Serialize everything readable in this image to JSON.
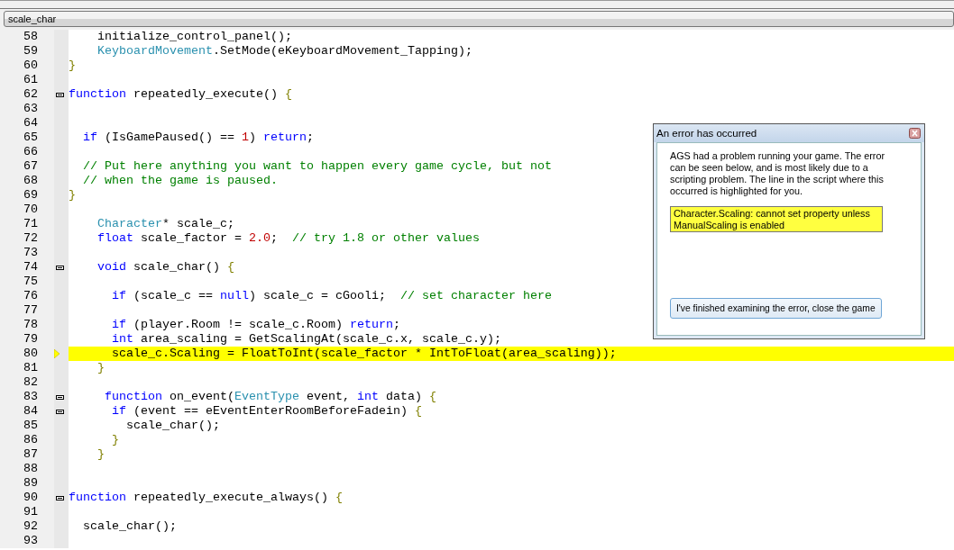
{
  "function_selector": {
    "value": "scale_char"
  },
  "code_lines": [
    {
      "number": "58",
      "fold": false,
      "current": false,
      "tokens": [
        {
          "kind": "plain",
          "text": "    initialize_control_panel();"
        }
      ]
    },
    {
      "number": "59",
      "fold": false,
      "current": false,
      "tokens": [
        {
          "kind": "type",
          "text": "    KeyboardMovement"
        },
        {
          "kind": "plain",
          "text": ".SetMode(eKeyboardMovement_Tapping);"
        }
      ]
    },
    {
      "number": "60",
      "fold": false,
      "current": false,
      "tokens": [
        {
          "kind": "brace",
          "text": "}"
        }
      ]
    },
    {
      "number": "61",
      "fold": false,
      "current": false
    },
    {
      "number": "62",
      "fold": true,
      "current": false,
      "tokens": [
        {
          "kind": "kw",
          "text": "function"
        },
        {
          "kind": "plain",
          "text": " repeatedly_execute() "
        },
        {
          "kind": "brace",
          "text": "{"
        }
      ]
    },
    {
      "number": "63",
      "fold": false,
      "current": false
    },
    {
      "number": "64",
      "fold": false,
      "current": false
    },
    {
      "number": "65",
      "fold": false,
      "current": false,
      "tokens": [
        {
          "kind": "kw",
          "text": "  if"
        },
        {
          "kind": "plain",
          "text": " (IsGamePaused() == "
        },
        {
          "kind": "num",
          "text": "1"
        },
        {
          "kind": "plain",
          "text": ") "
        },
        {
          "kind": "kw",
          "text": "return"
        },
        {
          "kind": "plain",
          "text": ";"
        }
      ]
    },
    {
      "number": "66",
      "fold": false,
      "current": false
    },
    {
      "number": "67",
      "fold": false,
      "current": false,
      "tokens": [
        {
          "kind": "cm",
          "text": "  // Put here anything you want to happen every game cycle, but not"
        }
      ]
    },
    {
      "number": "68",
      "fold": false,
      "current": false,
      "tokens": [
        {
          "kind": "cm",
          "text": "  // when the game is paused."
        }
      ]
    },
    {
      "number": "69",
      "fold": false,
      "current": false,
      "tokens": [
        {
          "kind": "brace",
          "text": "}"
        }
      ]
    },
    {
      "number": "70",
      "fold": false,
      "current": false
    },
    {
      "number": "71",
      "fold": false,
      "current": false,
      "tokens": [
        {
          "kind": "type",
          "text": "    Character"
        },
        {
          "kind": "plain",
          "text": "* scale_c;"
        }
      ]
    },
    {
      "number": "72",
      "fold": false,
      "current": false,
      "tokens": [
        {
          "kind": "kw",
          "text": "    float"
        },
        {
          "kind": "plain",
          "text": " scale_factor = "
        },
        {
          "kind": "num",
          "text": "2.0"
        },
        {
          "kind": "plain",
          "text": ";  "
        },
        {
          "kind": "cm",
          "text": "// try 1.8 or other values"
        }
      ]
    },
    {
      "number": "73",
      "fold": false,
      "current": false
    },
    {
      "number": "74",
      "fold": true,
      "current": false,
      "tokens": [
        {
          "kind": "kw",
          "text": "    void"
        },
        {
          "kind": "plain",
          "text": " scale_char() "
        },
        {
          "kind": "brace",
          "text": "{"
        }
      ]
    },
    {
      "number": "75",
      "fold": false,
      "current": false
    },
    {
      "number": "76",
      "fold": false,
      "current": false,
      "tokens": [
        {
          "kind": "kw",
          "text": "      if"
        },
        {
          "kind": "plain",
          "text": " (scale_c == "
        },
        {
          "kind": "kw",
          "text": "null"
        },
        {
          "kind": "plain",
          "text": ") scale_c = cGooli;  "
        },
        {
          "kind": "cm",
          "text": "// set character here"
        }
      ]
    },
    {
      "number": "77",
      "fold": false,
      "current": false
    },
    {
      "number": "78",
      "fold": false,
      "current": false,
      "tokens": [
        {
          "kind": "kw",
          "text": "      if"
        },
        {
          "kind": "plain",
          "text": " (player.Room != scale_c.Room) "
        },
        {
          "kind": "kw",
          "text": "return"
        },
        {
          "kind": "plain",
          "text": ";"
        }
      ]
    },
    {
      "number": "79",
      "fold": false,
      "current": false,
      "tokens": [
        {
          "kind": "kw",
          "text": "      int"
        },
        {
          "kind": "plain",
          "text": " area_scaling = GetScalingAt(scale_c.x, scale_c.y);"
        }
      ]
    },
    {
      "number": "80",
      "fold": false,
      "current": true,
      "tokens": [
        {
          "kind": "plain",
          "text": "      scale_c.Scaling = FloatToInt(scale_factor * IntToFloat(area_scaling));"
        }
      ]
    },
    {
      "number": "81",
      "fold": false,
      "current": false,
      "tokens": [
        {
          "kind": "brace",
          "text": "    }"
        }
      ]
    },
    {
      "number": "82",
      "fold": false,
      "current": false
    },
    {
      "number": "83",
      "fold": true,
      "current": false,
      "tokens": [
        {
          "kind": "kw",
          "text": "     function"
        },
        {
          "kind": "plain",
          "text": " on_event("
        },
        {
          "kind": "type",
          "text": "EventType"
        },
        {
          "kind": "plain",
          "text": " event, "
        },
        {
          "kind": "kw",
          "text": "int"
        },
        {
          "kind": "plain",
          "text": " data) "
        },
        {
          "kind": "brace",
          "text": "{"
        }
      ]
    },
    {
      "number": "84",
      "fold": true,
      "current": false,
      "tokens": [
        {
          "kind": "kw",
          "text": "      if"
        },
        {
          "kind": "plain",
          "text": " (event == eEventEnterRoomBeforeFadein) "
        },
        {
          "kind": "brace",
          "text": "{"
        }
      ]
    },
    {
      "number": "85",
      "fold": false,
      "current": false,
      "tokens": [
        {
          "kind": "plain",
          "text": "        scale_char();"
        }
      ]
    },
    {
      "number": "86",
      "fold": false,
      "current": false,
      "tokens": [
        {
          "kind": "brace",
          "text": "      }"
        }
      ]
    },
    {
      "number": "87",
      "fold": false,
      "current": false,
      "tokens": [
        {
          "kind": "brace",
          "text": "    }"
        }
      ]
    },
    {
      "number": "88",
      "fold": false,
      "current": false
    },
    {
      "number": "89",
      "fold": false,
      "current": false
    },
    {
      "number": "90",
      "fold": true,
      "current": false,
      "tokens": [
        {
          "kind": "kw",
          "text": "function"
        },
        {
          "kind": "plain",
          "text": " repeatedly_execute_always() "
        },
        {
          "kind": "brace",
          "text": "{"
        }
      ]
    },
    {
      "number": "91",
      "fold": false,
      "current": false
    },
    {
      "number": "92",
      "fold": false,
      "current": false,
      "tokens": [
        {
          "kind": "plain",
          "text": "  scale_char();"
        }
      ]
    },
    {
      "number": "93",
      "fold": false,
      "current": false
    }
  ],
  "error_dialog": {
    "title": "An error has occurred",
    "message": "AGS had a problem running your game. The error can be seen below, and is most likely due to a scripting problem. The line in the script where this occurred is highlighted for you.",
    "error": "Character.Scaling: cannot set property unless ManualScaling is enabled",
    "button": "I've finished examining the error, close the game"
  }
}
